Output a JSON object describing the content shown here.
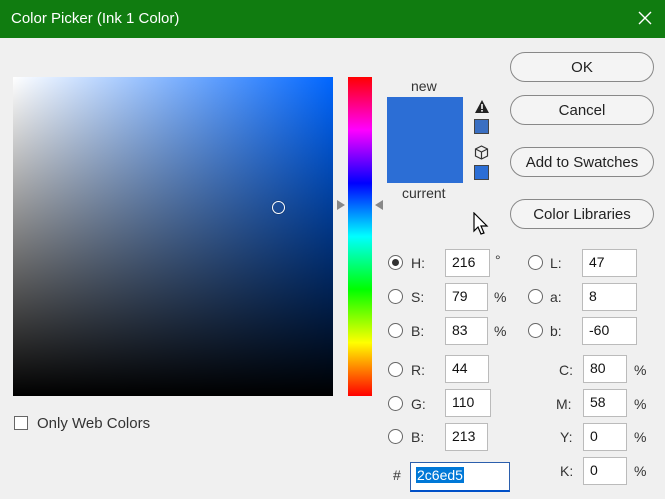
{
  "window": {
    "title": "Color Picker (Ink 1 Color)"
  },
  "colors": {
    "titlebar": "#107c10",
    "current": "#2c6ed5",
    "hue_base": "#0066ff"
  },
  "preview": {
    "new_label": "new",
    "current_label": "current"
  },
  "buttons": {
    "ok": "OK",
    "cancel": "Cancel",
    "add_swatches": "Add to Swatches",
    "color_libraries": "Color Libraries"
  },
  "hsb": {
    "h": {
      "label": "H:",
      "value": "216",
      "unit": "°",
      "selected": true
    },
    "s": {
      "label": "S:",
      "value": "79",
      "unit": "%"
    },
    "b": {
      "label": "B:",
      "value": "83",
      "unit": "%"
    }
  },
  "rgb": {
    "r": {
      "label": "R:",
      "value": "44"
    },
    "g": {
      "label": "G:",
      "value": "110"
    },
    "b": {
      "label": "B:",
      "value": "213"
    }
  },
  "lab": {
    "l": {
      "label": "L:",
      "value": "47"
    },
    "a": {
      "label": "a:",
      "value": "8"
    },
    "b": {
      "label": "b:",
      "value": "-60"
    }
  },
  "cmyk": {
    "c": {
      "label": "C:",
      "value": "80",
      "unit": "%"
    },
    "m": {
      "label": "M:",
      "value": "58",
      "unit": "%"
    },
    "y": {
      "label": "Y:",
      "value": "0",
      "unit": "%"
    },
    "k": {
      "label": "K:",
      "value": "0",
      "unit": "%"
    }
  },
  "hex": {
    "label": "#",
    "value": "2c6ed5"
  },
  "web_colors": {
    "label": "Only Web Colors",
    "checked": false
  }
}
